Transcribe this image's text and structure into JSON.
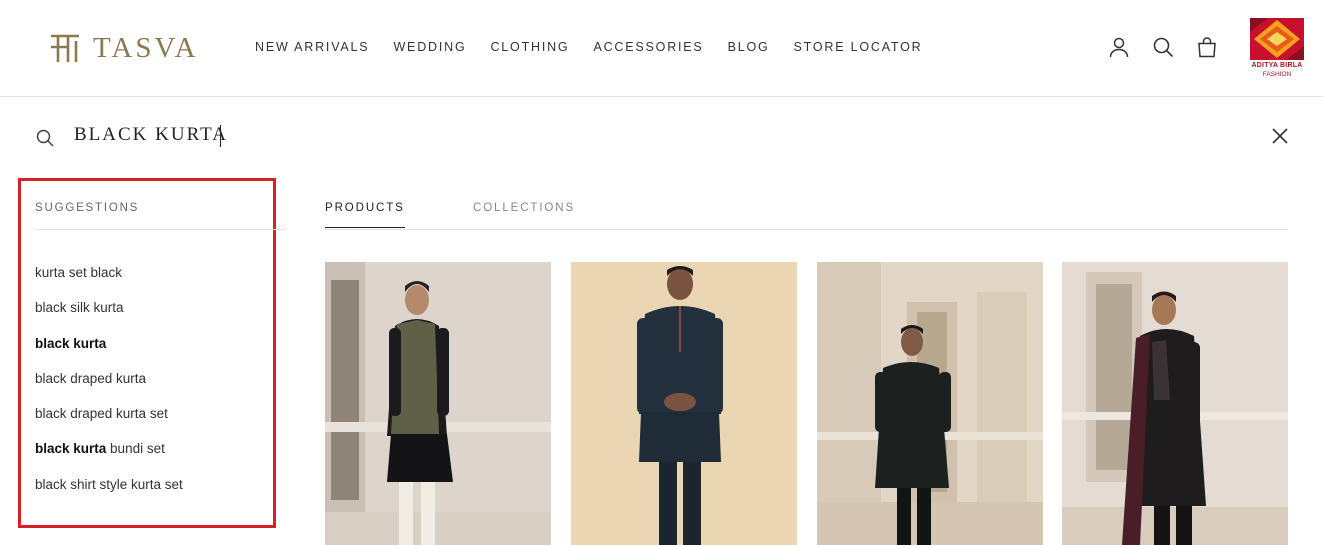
{
  "header": {
    "logo_text": "TASVA",
    "nav": [
      "NEW ARRIVALS",
      "WEDDING",
      "CLOTHING",
      "ACCESSORIES",
      "BLOG",
      "STORE LOCATOR"
    ],
    "icons": [
      "account-icon",
      "search-icon",
      "cart-icon"
    ],
    "brand": {
      "name": "ADITYA BIRLA",
      "sub": "FASHION"
    }
  },
  "search": {
    "value": "BLACK KURTA",
    "icon": "search-icon",
    "close_icon": "close-icon"
  },
  "suggestions": {
    "title": "SUGGESTIONS",
    "items": [
      {
        "bold": "",
        "rest": "kurta set black"
      },
      {
        "bold": "",
        "rest": "black silk kurta"
      },
      {
        "bold": "black kurta",
        "rest": ""
      },
      {
        "bold": "",
        "rest": "black draped kurta"
      },
      {
        "bold": "",
        "rest": "black draped kurta set"
      },
      {
        "bold": "black kurta",
        "rest": " bundi set"
      },
      {
        "bold": "",
        "rest": "black shirt style kurta set"
      }
    ]
  },
  "tabs": {
    "products": "PRODUCTS",
    "collections": "COLLECTIONS",
    "active": "PRODUCTS"
  },
  "colors": {
    "accent_gold": "#8a7a52",
    "highlight_red": "#d7202b",
    "brand_red": "#b0121f"
  }
}
